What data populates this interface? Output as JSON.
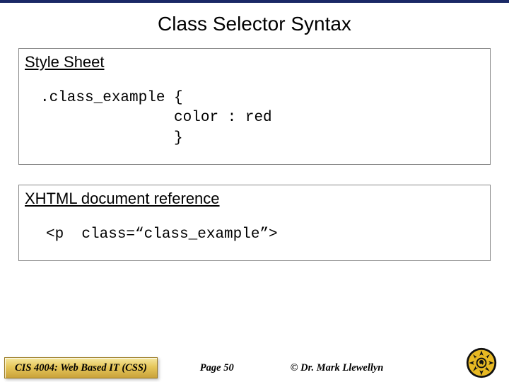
{
  "title": "Class Selector Syntax",
  "panel1": {
    "label": "Style Sheet",
    "code": ".class_example {\n               color : red\n               }"
  },
  "panel2": {
    "label": "XHTML document reference",
    "code": "<p  class=“class_example”>"
  },
  "footer": {
    "course": "CIS 4004: Web Based IT (CSS)",
    "page": "Page 50",
    "copyright": "© Dr. Mark Llewellyn"
  }
}
